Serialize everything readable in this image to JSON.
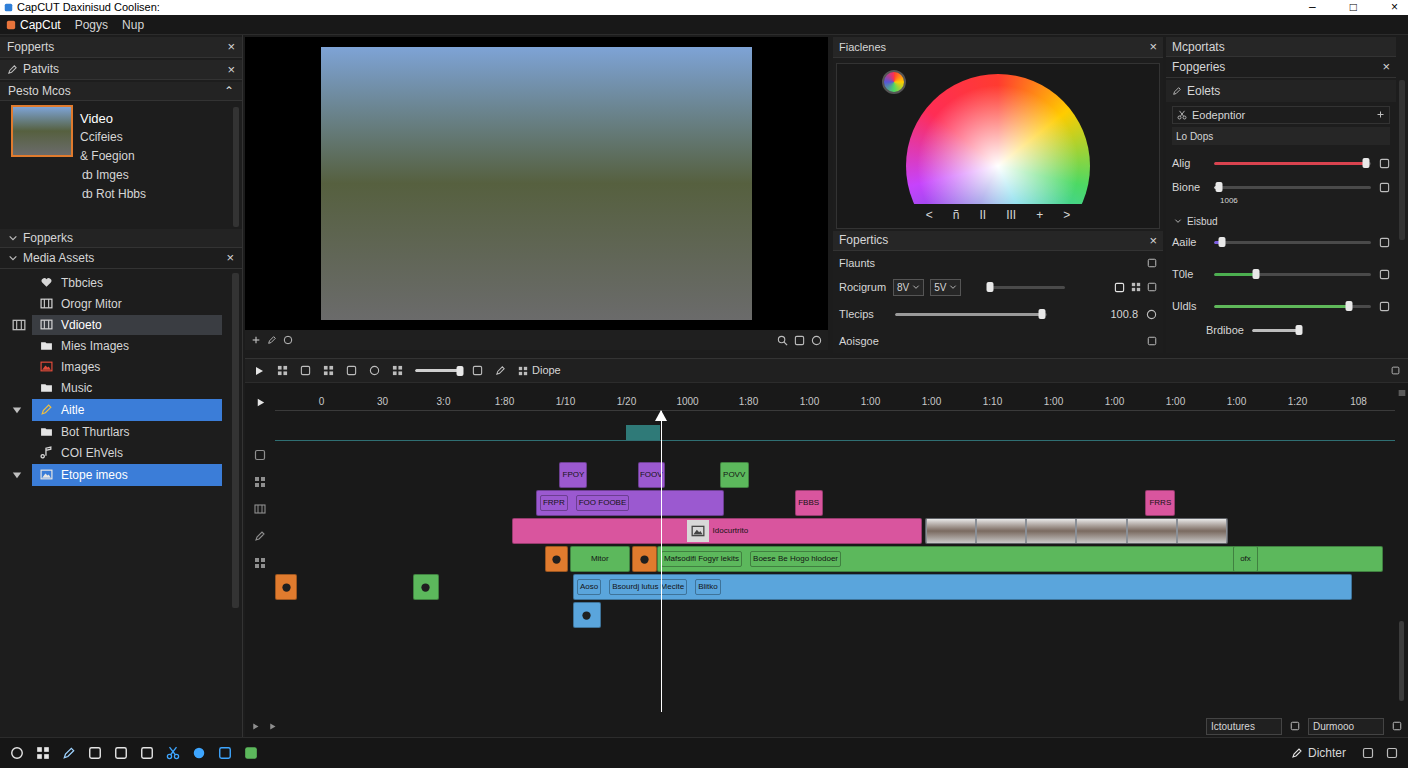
{
  "window": {
    "title": "CapCUT Daxinisud Coolisen:",
    "controls": [
      "–",
      "□",
      "×"
    ]
  },
  "menu": {
    "app": "CapCut",
    "items": [
      "Pogys",
      "Nup"
    ]
  },
  "left_panel": {
    "panels": [
      {
        "label": "Fopperts",
        "close": "×"
      },
      {
        "label": "Patvits",
        "close": "×"
      }
    ],
    "photo_section": {
      "label": "Pesto Mcos",
      "toggle": "⌃",
      "title": "Video",
      "items": [
        "Ccifeies",
        "& Foegion",
        "ȸ Imges",
        "ȸ Rot Hbbs"
      ]
    },
    "properties": {
      "label": "Fopperks",
      "expanded": true
    },
    "media_assets": {
      "label": "Media Assets",
      "close": "×",
      "expanded": true,
      "items": [
        {
          "label": "Tbbcies",
          "selected": false,
          "hovered": false,
          "group": false,
          "expanded": false
        },
        {
          "label": "Orogr Mitor",
          "selected": false,
          "hovered": false,
          "group": false,
          "expanded": false
        },
        {
          "label": "Vdioeto",
          "selected": false,
          "hovered": true,
          "group": false,
          "expanded": false
        },
        {
          "label": "Mies Images",
          "selected": false,
          "hovered": false,
          "group": false,
          "expanded": false
        },
        {
          "label": "Images",
          "selected": false,
          "hovered": false,
          "group": false,
          "expanded": false
        },
        {
          "label": "Music",
          "selected": false,
          "hovered": false,
          "group": false,
          "expanded": false
        },
        {
          "label": "Aitle",
          "selected": true,
          "hovered": false,
          "group": true,
          "expanded": true
        },
        {
          "label": "Bot Thurtlars",
          "selected": false,
          "hovered": false,
          "group": false,
          "expanded": false
        },
        {
          "label": "COI EhVels",
          "selected": false,
          "hovered": false,
          "group": false,
          "expanded": false
        },
        {
          "label": "Etope imeos",
          "selected": true,
          "hovered": false,
          "group": true,
          "expanded": true
        }
      ]
    }
  },
  "effects_panel": {
    "title": "Fiaclenes",
    "close": "×",
    "transport": [
      "<",
      "ñ",
      "II",
      "III",
      "+",
      ">"
    ]
  },
  "properties_panel": {
    "title": "Fopertics",
    "close": "×",
    "rows": [
      {
        "kind": "heading",
        "label": "Flaunts"
      },
      {
        "kind": "controls",
        "label": "Rocigrum",
        "selects": [
          "8V",
          "5V"
        ],
        "level": 0.03
      },
      {
        "kind": "slider",
        "label": "Tlecips",
        "level": 0.97,
        "reading": "100.8"
      },
      {
        "kind": "heading",
        "label": "Aoisgoe"
      }
    ]
  },
  "inspector": {
    "tab": "Mcportats",
    "title": "Fopgeries",
    "close": "×",
    "section": "Eolets",
    "item": "Eodepntior",
    "field": "Lo Dops",
    "sliders": [
      {
        "label": "Alig",
        "level": 0.97,
        "sublabel": "",
        "color": "#d9434f"
      },
      {
        "label": "Bione",
        "level": 0.03,
        "sublabel": "1006",
        "color": "#cfcfcf"
      }
    ],
    "group": {
      "label": "Eisbud",
      "expanded": true,
      "sliders": [
        {
          "label": "Aaile",
          "level": 0.05,
          "color": "#7b5ce0"
        },
        {
          "label": "T0le",
          "level": 0.27,
          "color": "#4caf50"
        },
        {
          "label": "Uldls",
          "level": 0.86,
          "color": "#5fb85a"
        }
      ]
    },
    "footer_slider": {
      "label": "Brdiboe",
      "level": 0.94
    }
  },
  "timeline": {
    "toolbar_label": "Diope",
    "toolbar_slider": {
      "level": 1
    },
    "ruler": [
      "0",
      "30",
      "3:0",
      "1:80",
      "1/10",
      "1/20",
      "1000",
      "1:80",
      "1:00",
      "1:00",
      "1:00",
      "1:10",
      "1:00",
      "1:00",
      "1:00",
      "1:00",
      "1:20",
      "108"
    ],
    "playhead": 0.345,
    "range": {
      "from": 0.313,
      "to": 0.344
    },
    "tracks": [
      [
        {
          "kind": "label",
          "from": 0.254,
          "to": 0.279,
          "color": "#9b59d0",
          "labels": [
            "FPOY"
          ],
          "thumb": false
        },
        {
          "kind": "label",
          "from": 0.324,
          "to": 0.348,
          "color": "#9b59d0",
          "labels": [
            "FOOV"
          ],
          "thumb": false
        },
        {
          "kind": "label",
          "from": 0.397,
          "to": 0.423,
          "color": "#5cb85c",
          "labels": [
            "POVV"
          ],
          "thumb": false
        }
      ],
      [
        {
          "kind": "label",
          "from": 0.233,
          "to": 0.401,
          "color": "#9b59d0",
          "labels": [
            "FRPR",
            "FOO FOOBE"
          ],
          "thumb": false
        },
        {
          "kind": "label",
          "from": 0.464,
          "to": 0.489,
          "color": "#d9559e",
          "labels": [
            "FBBS"
          ],
          "thumb": false
        },
        {
          "kind": "label",
          "from": 0.777,
          "to": 0.804,
          "color": "#d9559e",
          "labels": [
            "FRRS"
          ],
          "thumb": false
        }
      ],
      [
        {
          "kind": "label",
          "from": 0.212,
          "to": 0.578,
          "color": "#d9559e",
          "labels": [
            "Idocurtrito"
          ],
          "thumb": true
        },
        {
          "kind": "frames",
          "from": 0.58,
          "to": 0.851,
          "color": "#8a8f96",
          "labels": [],
          "thumb": false
        }
      ],
      [
        {
          "kind": "icon",
          "from": 0.241,
          "to": 0.262,
          "color": "#e07b2e",
          "labels": [],
          "thumb": false
        },
        {
          "kind": "label",
          "from": 0.263,
          "to": 0.317,
          "color": "#5cb85c",
          "labels": [
            "Mitor"
          ],
          "thumb": false
        },
        {
          "kind": "icon",
          "from": 0.319,
          "to": 0.341,
          "color": "#e07b2e",
          "labels": [],
          "thumb": false
        },
        {
          "kind": "label",
          "from": 0.341,
          "to": 0.989,
          "color": "#5cb85c",
          "labels": [
            "Mafsodifi Fogyr lekits",
            "Boese Be Hogo hlodoer"
          ],
          "thumb": false
        },
        {
          "kind": "tag",
          "from": 0.855,
          "to": 0.878,
          "color": "#5cb85c",
          "labels": [
            "ofx"
          ],
          "thumb": false
        }
      ],
      [
        {
          "kind": "icon",
          "from": 0.0,
          "to": 0.02,
          "color": "#e07b2e",
          "labels": [],
          "thumb": false
        },
        {
          "kind": "icon",
          "from": 0.123,
          "to": 0.146,
          "color": "#5cb85c",
          "labels": [],
          "thumb": false
        },
        {
          "kind": "label",
          "from": 0.266,
          "to": 0.962,
          "color": "#5aa5dc",
          "labels": [
            "Aoso",
            "Bsourdj lutus Mecite",
            "Blitko"
          ],
          "thumb": false
        }
      ],
      [
        {
          "kind": "icon",
          "from": 0.266,
          "to": 0.291,
          "color": "#5aa5dc",
          "labels": [],
          "thumb": false
        }
      ]
    ],
    "footer_fields": [
      "Ictoutures",
      "Durmooo"
    ]
  },
  "bottom_bar": {
    "button": "Dichter"
  }
}
